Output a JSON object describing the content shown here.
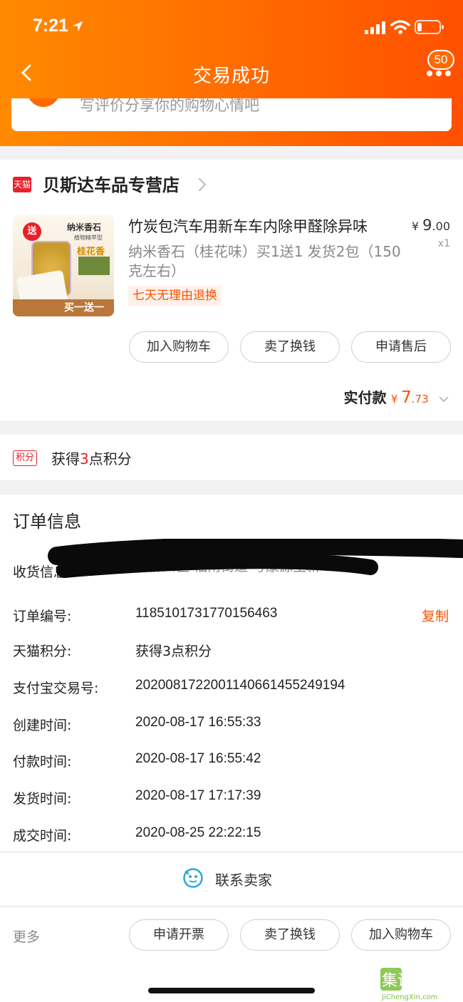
{
  "status_bar": {
    "time": "7:21",
    "battery_level": 0.2
  },
  "nav": {
    "title": "交易成功",
    "badge_count": "50"
  },
  "review_prompt": {
    "text": "写评价分享你的购物心情吧"
  },
  "store": {
    "platform_logo": "天猫",
    "name": "贝斯达车品专营店",
    "item": {
      "thumb_badge": "送",
      "thumb_title": "纳米香石",
      "thumb_subtitle": "植物精萃型",
      "thumb_scent": "桂花香",
      "thumb_banner": "买一送一",
      "title": "竹炭包汽车用新车车内除甲醛除异味",
      "spec": "纳米香石（桂花味）买1送1 发货2包（150克左右）",
      "currency": "¥",
      "price_int": "9",
      "price_dec": ".00",
      "qty": "x1",
      "return_tag": "七天无理由退换"
    },
    "buttons": [
      "加入购物车",
      "卖了换钱",
      "申请售后"
    ],
    "paid_label": "实付款",
    "paid_currency": "¥",
    "paid_int": "7",
    "paid_dec": ".73"
  },
  "points": {
    "tag": "积分",
    "prefix": "获得",
    "value": "3",
    "suffix": "点积分"
  },
  "order_info": {
    "title": "订单信息",
    "address_label": "收货信息",
    "address_value_visible": "市柳州区 福南街道 号康源至新",
    "copy_label": "复制",
    "rows": [
      {
        "label": "订单编号:",
        "value": "1185101731770156463"
      },
      {
        "label": "天猫积分:",
        "value": "获得3点积分"
      },
      {
        "label": "支付宝交易号:",
        "value": "2020081722001140661455249194"
      },
      {
        "label": "创建时间:",
        "value": "2020-08-17 16:55:33"
      },
      {
        "label": "付款时间:",
        "value": "2020-08-17 16:55:42"
      },
      {
        "label": "发货时间:",
        "value": "2020-08-17 17:17:39"
      },
      {
        "label": "成交时间:",
        "value": "2020-08-25 22:22:15"
      }
    ]
  },
  "contact": {
    "label": "联系卖家"
  },
  "bottom": {
    "more_label": "更多",
    "buttons": [
      "申请开票",
      "卖了换钱",
      "加入购物车"
    ]
  },
  "watermark": {
    "text": "集诚信",
    "url_text": "JiChengXin.com"
  },
  "colors": {
    "accent": "#ff5000",
    "header_start": "#ff8a00",
    "header_end": "#ff5000",
    "tmall_red": "#e8202a"
  }
}
